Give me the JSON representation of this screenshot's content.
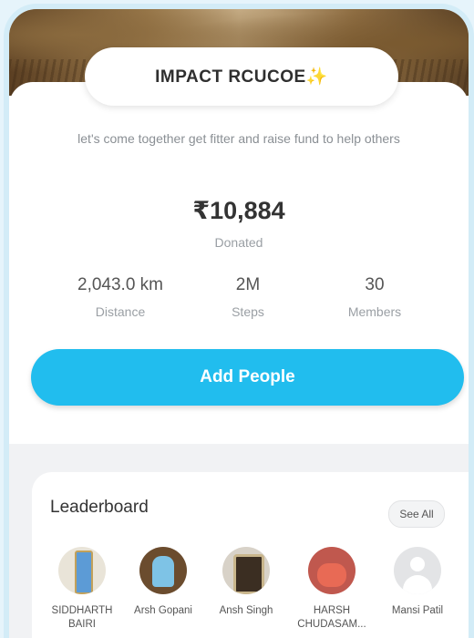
{
  "header": {
    "title": "IMPACT RCUCOE✨",
    "tagline": "let's come together get fitter and raise fund to help others"
  },
  "donation": {
    "amount": "₹10,884",
    "label": "Donated"
  },
  "stats": [
    {
      "value": "2,043.0 km",
      "label": "Distance"
    },
    {
      "value": "2M",
      "label": "Steps"
    },
    {
      "value": "30",
      "label": "Members"
    }
  ],
  "actions": {
    "add_people_label": "Add People"
  },
  "leaderboard": {
    "title": "Leaderboard",
    "see_all_label": "See All",
    "members": [
      {
        "name": "SIDDHARTH BAIRI"
      },
      {
        "name": "Arsh Gopani"
      },
      {
        "name": "Ansh Singh"
      },
      {
        "name": "HARSH CHUDASAM..."
      },
      {
        "name": "Mansi Patil"
      }
    ]
  },
  "colors": {
    "accent": "#21bdee",
    "frame": "#d3ecf7"
  }
}
